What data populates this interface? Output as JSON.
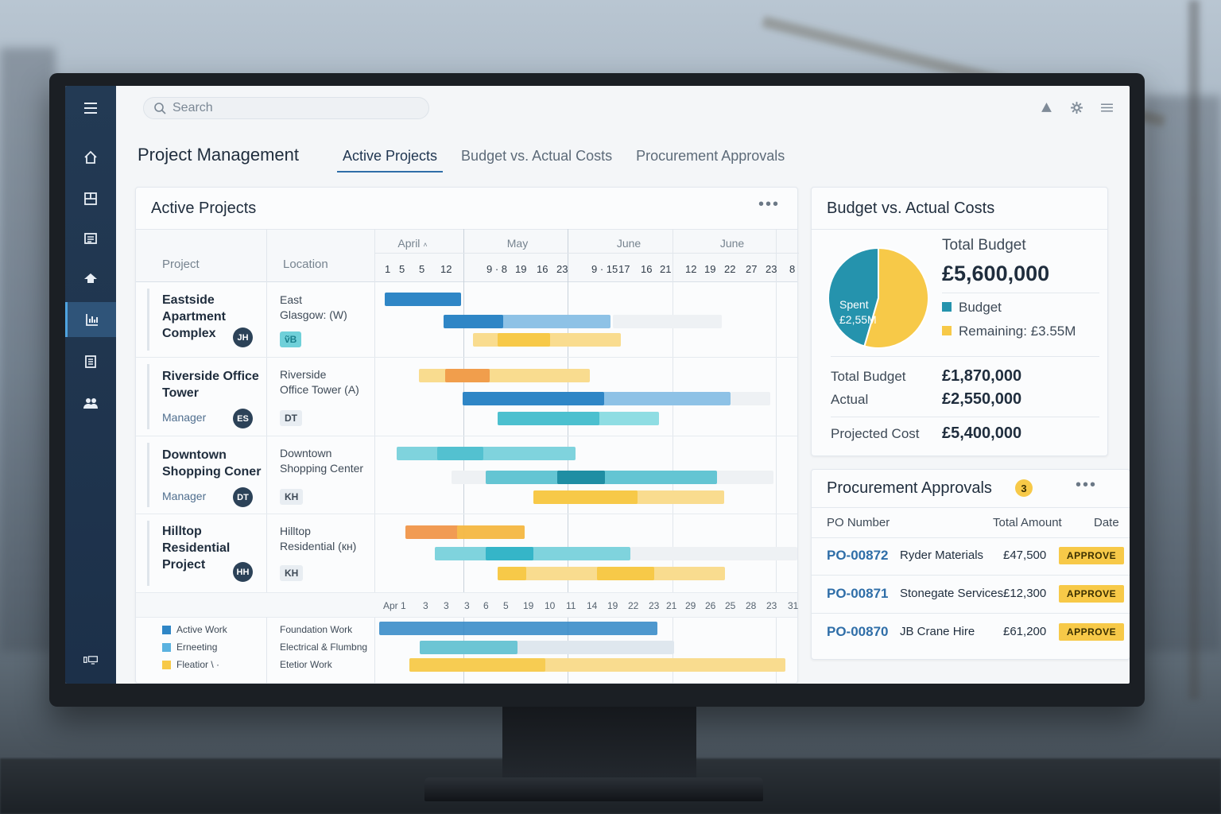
{
  "search": {
    "placeholder": "Search"
  },
  "header": {
    "title": "Project Management",
    "tabs": [
      {
        "label": "Active Projects",
        "active": true
      },
      {
        "label": "Budget vs. Actual Costs",
        "active": false
      },
      {
        "label": "Procurement Approvals",
        "active": false
      }
    ]
  },
  "sidebar": {
    "icons": [
      "menu-icon",
      "home-icon",
      "dashboard-icon",
      "reports-icon",
      "site-icon",
      "analytics-icon",
      "documents-icon",
      "team-icon",
      "device-icon"
    ],
    "active": "analytics-icon"
  },
  "topbar_icons": [
    "notification-icon",
    "settings-icon",
    "more-menu-icon"
  ],
  "gantt": {
    "title": "Active Projects",
    "col_project": "Project",
    "col_location": "Location",
    "months": [
      "April",
      "May",
      "June",
      "June"
    ],
    "month_dropdown_glyph": "˄",
    "days": [
      "1",
      "5",
      "5",
      "12",
      "9 · 8",
      "19",
      "16",
      "23",
      "9 · 15",
      "17",
      "16",
      "21",
      "12",
      "19",
      "22",
      "27",
      "23",
      "8"
    ],
    "projects": [
      {
        "name": "Eastside Apartment Complex",
        "manager": "",
        "initials": "JH",
        "location": "East\nGlasgow: (W)",
        "tag": "ṽB",
        "tag_style": "teal"
      },
      {
        "name": "Riverside Office Tower",
        "manager": "Manager",
        "initials": "ES",
        "location": "Riverside\nOffice Tower (A)",
        "tag": "DT",
        "tag_style": "plain"
      },
      {
        "name": "Downtown Shopping Coner",
        "manager": "Manager",
        "initials": "DT",
        "location": "Downtown\nShopping Center",
        "tag": "KH",
        "tag_style": "plain"
      },
      {
        "name": "Hilltop Residential Project",
        "manager": "",
        "initials": "HH",
        "location": "Hilltop\nResidential (кн)",
        "tag": "KH",
        "tag_style": "plain"
      }
    ],
    "axis_labels": [
      "Apr 1",
      "3",
      "3",
      "3",
      "6",
      "5",
      "19",
      "10",
      "11",
      "14",
      "19",
      "22",
      "23",
      "21",
      "29",
      "26",
      "25",
      "28",
      "23",
      "31"
    ],
    "legend": [
      {
        "label": "Active Work",
        "color": "#2f86c6"
      },
      {
        "label": "Erneeting",
        "color": "#5ab2e0"
      },
      {
        "label": "Fleatior \\ ·",
        "color": "#f7c948"
      }
    ],
    "legend_phases": [
      "Foundation Work",
      "Electrical & Flumbng",
      "Etetior Work"
    ],
    "colors": {
      "blue": "#2f86c6",
      "light_blue": "#8ec2e6",
      "teal": "#35b5c8",
      "yellow": "#f7c948",
      "light_yellow": "#f9dc8f",
      "orange": "#ee8a35"
    }
  },
  "budget": {
    "title": "Budget vs. Actual Costs",
    "pie_label": "Spent",
    "pie_value": "£2,55M",
    "spent_fraction": 0.455,
    "total_budget_label": "Total Budget",
    "total_budget_value": "£5,600,000",
    "legend_budget": "Budget",
    "legend_remaining": "Remaining: £3.55M",
    "rows": [
      {
        "label": "Total Budget",
        "value": "£1,870,000"
      },
      {
        "label": "Actual",
        "value": "£2,550,000"
      },
      {
        "label": "Projected Cost",
        "value": "£5,400,000"
      }
    ],
    "colors": {
      "spent": "#2593ad",
      "remaining": "#f7c948"
    }
  },
  "procurement": {
    "title": "Procurement Approvals",
    "count": "3",
    "headers": {
      "po": "PO Number",
      "amount": "Total Amount",
      "date": "Date"
    },
    "rows": [
      {
        "po": "PO-00872",
        "vendor": "Ryder Materials",
        "amount": "£47,500",
        "action": "APPROVE"
      },
      {
        "po": "PO-00871",
        "vendor": "Stonegate Services",
        "amount": "£12,300",
        "action": "APPROVE"
      },
      {
        "po": "PO-00870",
        "vendor": "JB Crane Hire",
        "amount": "£61,200",
        "action": "APPROVE"
      }
    ]
  }
}
